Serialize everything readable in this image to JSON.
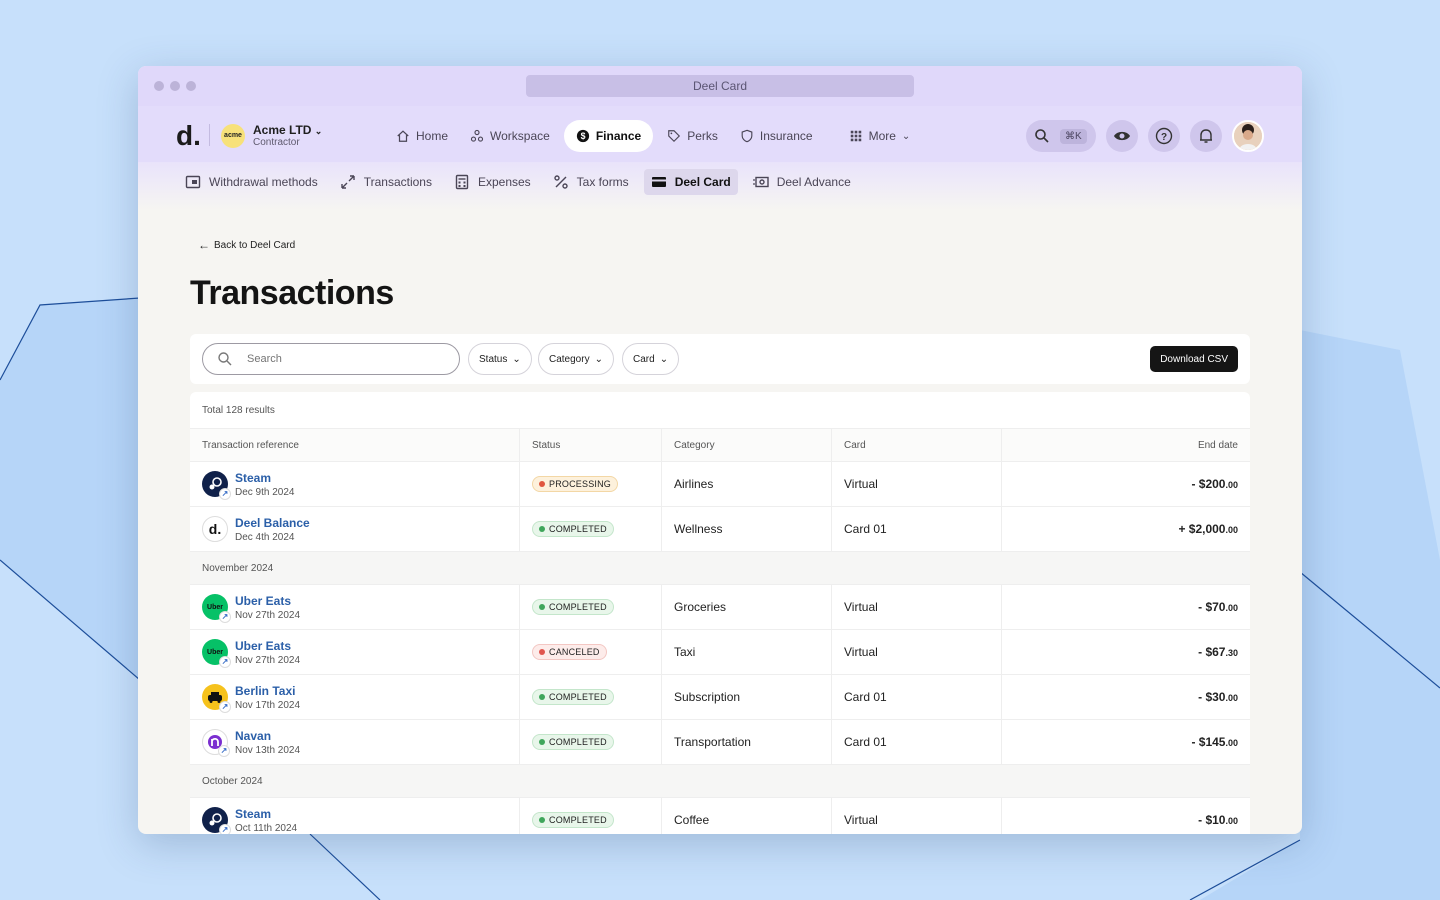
{
  "window": {
    "url_title": "Deel Card"
  },
  "org": {
    "logo_text": "acme",
    "name": "Acme LTD",
    "role": "Contractor"
  },
  "brand": {
    "logo": "d."
  },
  "main_nav": [
    {
      "label": "Home",
      "icon": "home-icon"
    },
    {
      "label": "Workspace",
      "icon": "workspace-icon"
    },
    {
      "label": "Finance",
      "icon": "dollar-icon",
      "active": true
    },
    {
      "label": "Perks",
      "icon": "tag-icon"
    },
    {
      "label": "Insurance",
      "icon": "shield-icon"
    },
    {
      "label": "More",
      "icon": "grid-icon"
    }
  ],
  "tools": {
    "shortcut": "⌘K"
  },
  "sub_nav": [
    {
      "label": "Withdrawal methods"
    },
    {
      "label": "Transactions"
    },
    {
      "label": "Expenses"
    },
    {
      "label": "Tax forms"
    },
    {
      "label": "Deel Card",
      "active": true
    },
    {
      "label": "Deel Advance"
    }
  ],
  "back_link": "Back to Deel Card",
  "page_title": "Transactions",
  "toolbar": {
    "search_placeholder": "Search",
    "filters": [
      "Status",
      "Category",
      "Card"
    ],
    "download_label": "Download CSV"
  },
  "table": {
    "total": "Total 128 results",
    "columns": [
      "Transaction reference",
      "Status",
      "Category",
      "Card",
      "End date"
    ],
    "groups": [
      "November 2024",
      "October 2024"
    ],
    "rows": [
      {
        "merchant": "Steam",
        "date": "Dec 9th 2024",
        "status": "PROCESSING",
        "category": "Airlines",
        "card": "Virtual",
        "amount": "- $200",
        "cents": ".00"
      },
      {
        "merchant": "Deel Balance",
        "date": "Dec 4th 2024",
        "status": "COMPLETED",
        "category": "Wellness",
        "card": "Card 01",
        "amount": "+ $2,000",
        "cents": ".00"
      },
      {
        "merchant": "Uber Eats",
        "date": "Nov 27th 2024",
        "status": "COMPLETED",
        "category": "Groceries",
        "card": "Virtual",
        "amount": "- $70",
        "cents": ".00"
      },
      {
        "merchant": "Uber Eats",
        "date": "Nov 27th 2024",
        "status": "CANCELED",
        "category": "Taxi",
        "card": "Virtual",
        "amount": "- $67",
        "cents": ".30"
      },
      {
        "merchant": "Berlin Taxi",
        "date": "Nov 17th 2024",
        "status": "COMPLETED",
        "category": "Subscription",
        "card": "Card 01",
        "amount": "- $30",
        "cents": ".00"
      },
      {
        "merchant": "Navan",
        "date": "Nov 13th 2024",
        "status": "COMPLETED",
        "category": "Transportation",
        "card": "Card 01",
        "amount": "- $145",
        "cents": ".00"
      },
      {
        "merchant": "Steam",
        "date": "Oct 11th 2024",
        "status": "COMPLETED",
        "category": "Coffee",
        "card": "Virtual",
        "amount": "- $10",
        "cents": ".00"
      }
    ]
  },
  "colors": {
    "nav_bg": "#e3dcfb",
    "processing": "#e5a33b",
    "completed": "#3fa65b",
    "canceled": "#e0564f",
    "link": "#2b5fa8"
  }
}
